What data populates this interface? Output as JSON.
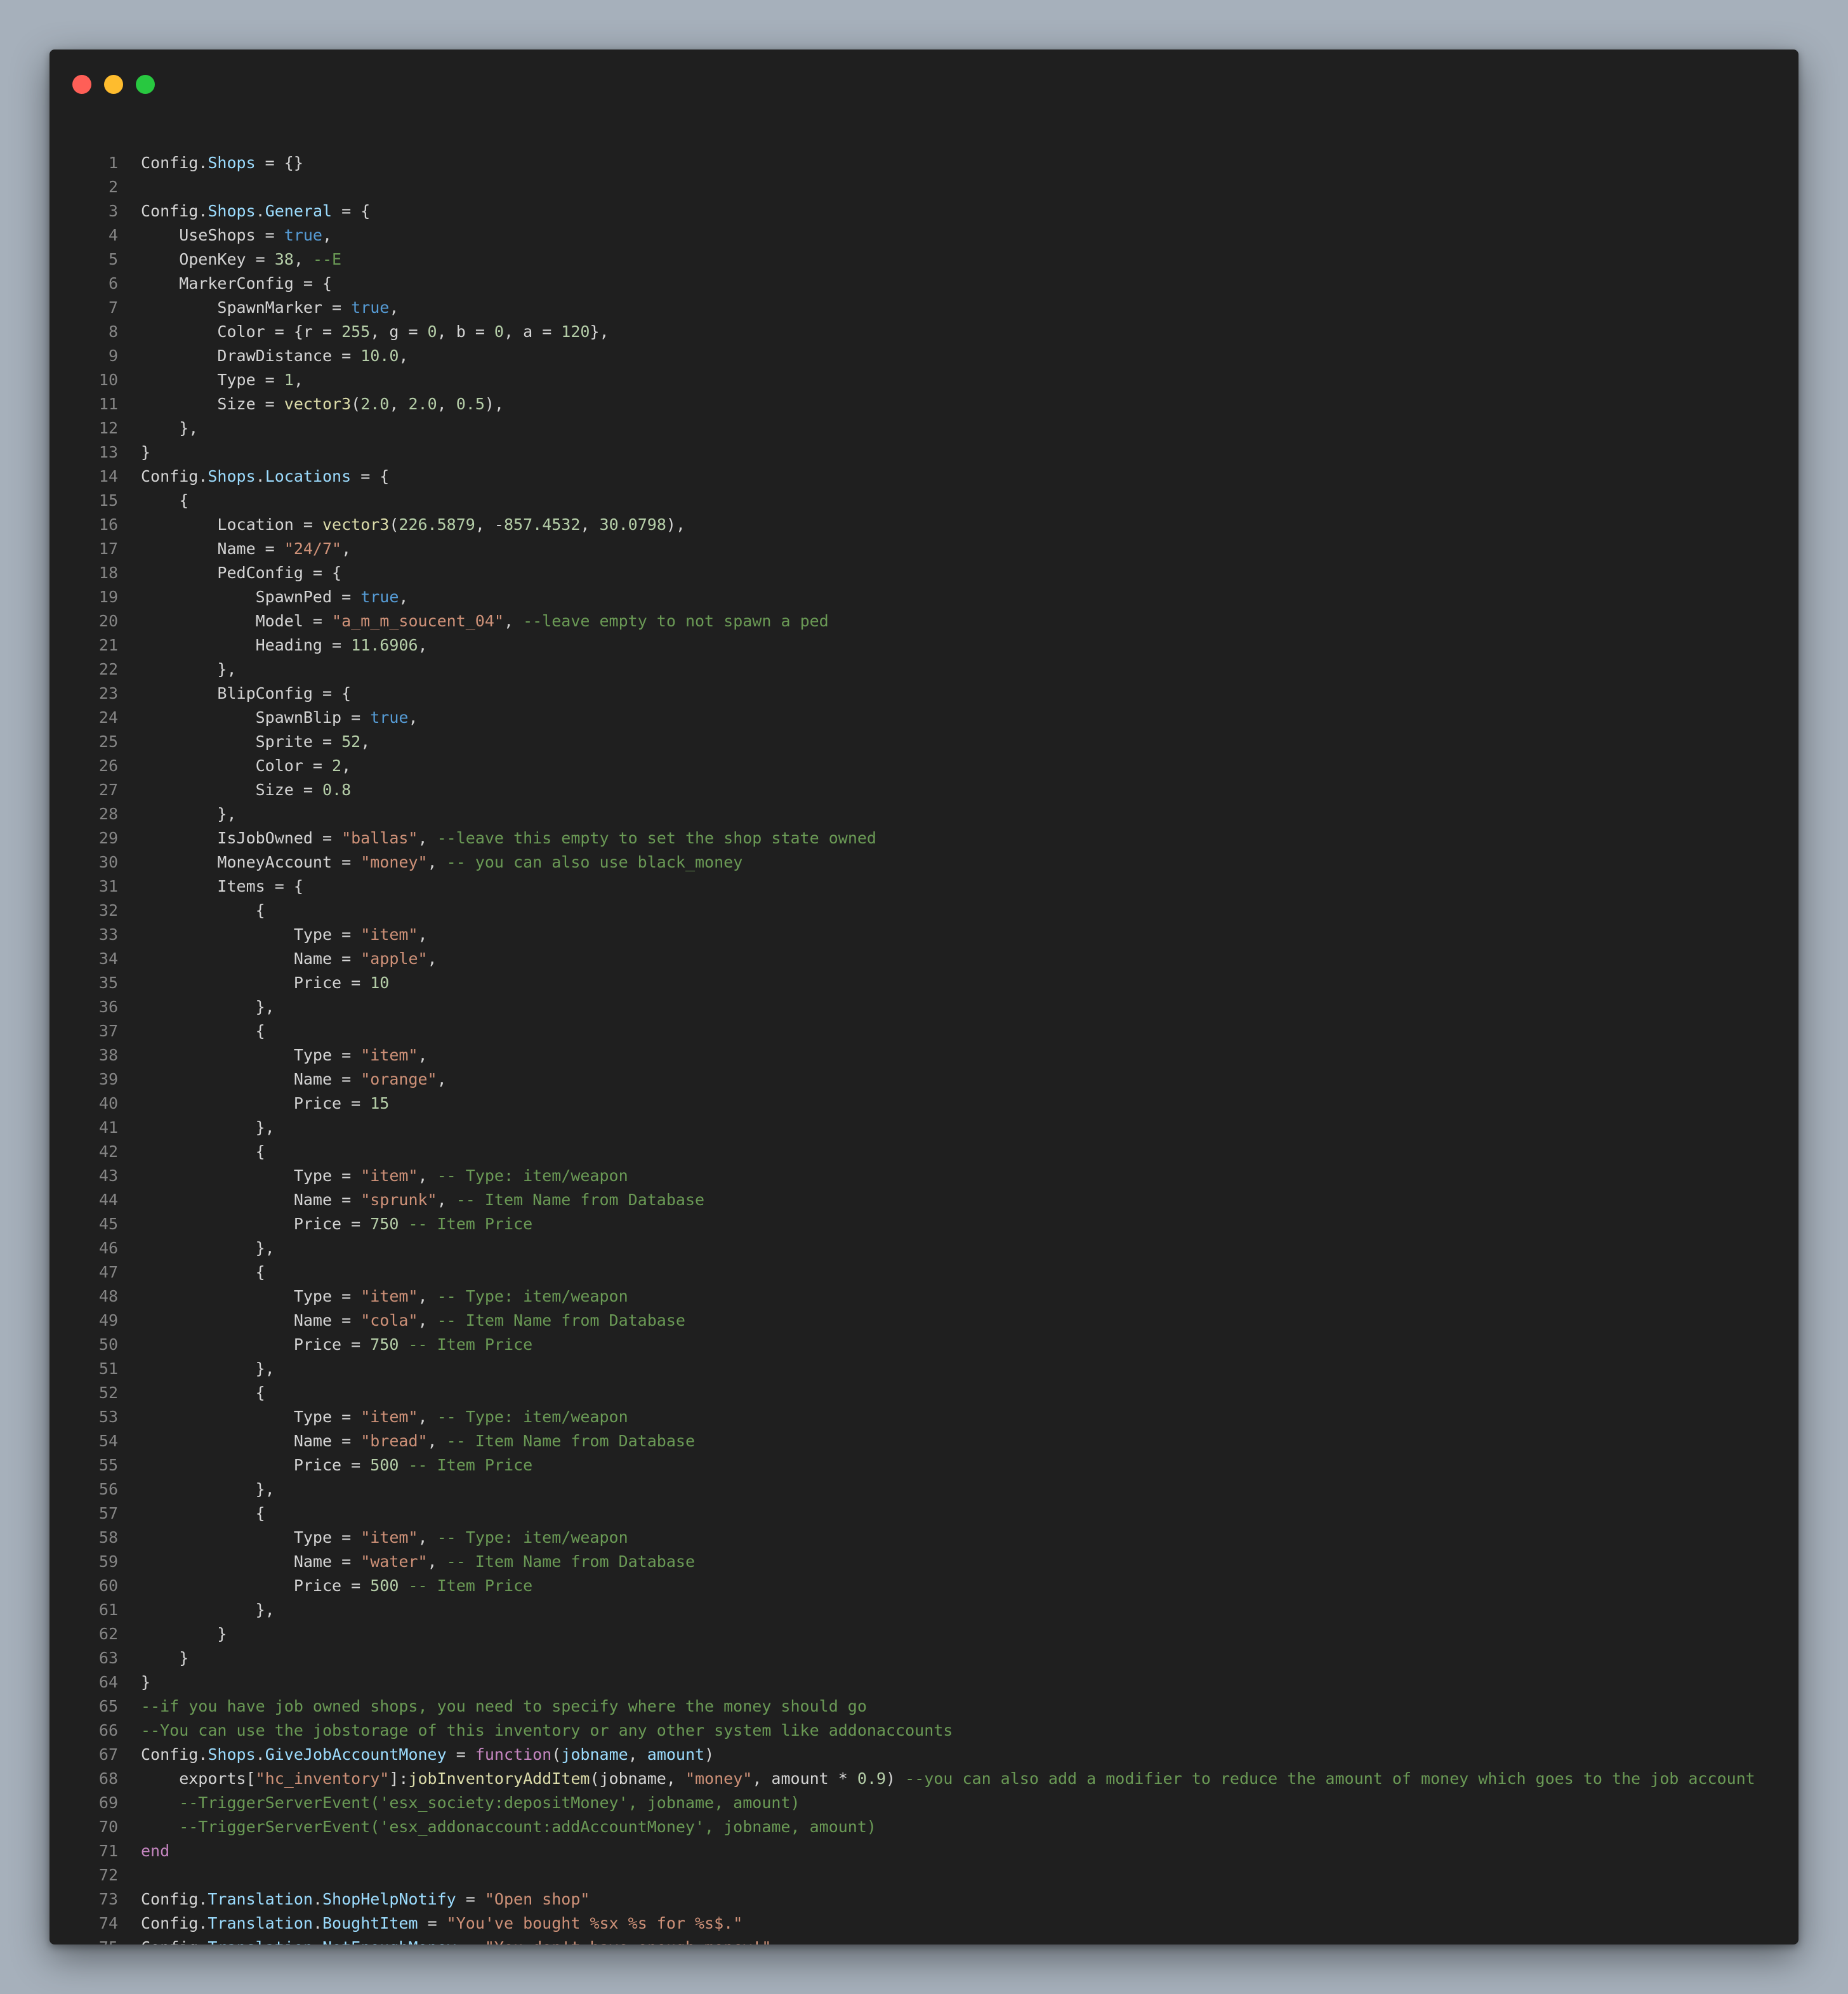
{
  "window": {
    "controls": [
      {
        "name": "close",
        "color": "#ff5f57"
      },
      {
        "name": "minimize",
        "color": "#febc2e"
      },
      {
        "name": "maximize",
        "color": "#28c840"
      }
    ]
  },
  "colors": {
    "plain": "#d4d4d4",
    "property": "#9cdcfe",
    "boolean": "#569cd6",
    "number": "#b5cea8",
    "string": "#ce9178",
    "comment": "#6a9955",
    "function": "#dcdcaa",
    "control": "#c586c0",
    "line_number": "#858585",
    "background": "#1f1f1f"
  },
  "code": {
    "lines": [
      [
        [
          "p",
          "Config."
        ],
        [
          "prop",
          "Shops"
        ],
        [
          "p",
          " = {}"
        ]
      ],
      [],
      [
        [
          "p",
          "Config."
        ],
        [
          "prop",
          "Shops"
        ],
        [
          "p",
          "."
        ],
        [
          "prop",
          "General"
        ],
        [
          "p",
          " = {"
        ]
      ],
      [
        [
          "p",
          "    UseShops = "
        ],
        [
          "kw",
          "true"
        ],
        [
          "p",
          ","
        ]
      ],
      [
        [
          "p",
          "    OpenKey = "
        ],
        [
          "num",
          "38"
        ],
        [
          "p",
          ", "
        ],
        [
          "com",
          "--E"
        ]
      ],
      [
        [
          "p",
          "    MarkerConfig = {"
        ]
      ],
      [
        [
          "p",
          "        SpawnMarker = "
        ],
        [
          "kw",
          "true"
        ],
        [
          "p",
          ","
        ]
      ],
      [
        [
          "p",
          "        Color = {r = "
        ],
        [
          "num",
          "255"
        ],
        [
          "p",
          ", g = "
        ],
        [
          "num",
          "0"
        ],
        [
          "p",
          ", b = "
        ],
        [
          "num",
          "0"
        ],
        [
          "p",
          ", a = "
        ],
        [
          "num",
          "120"
        ],
        [
          "p",
          "},"
        ]
      ],
      [
        [
          "p",
          "        DrawDistance = "
        ],
        [
          "num",
          "10.0"
        ],
        [
          "p",
          ","
        ]
      ],
      [
        [
          "p",
          "        Type = "
        ],
        [
          "num",
          "1"
        ],
        [
          "p",
          ","
        ]
      ],
      [
        [
          "p",
          "        Size = "
        ],
        [
          "fn",
          "vector3"
        ],
        [
          "p",
          "("
        ],
        [
          "num",
          "2.0"
        ],
        [
          "p",
          ", "
        ],
        [
          "num",
          "2.0"
        ],
        [
          "p",
          ", "
        ],
        [
          "num",
          "0.5"
        ],
        [
          "p",
          "),"
        ]
      ],
      [
        [
          "p",
          "    },"
        ]
      ],
      [
        [
          "p",
          "}"
        ]
      ],
      [
        [
          "p",
          "Config."
        ],
        [
          "prop",
          "Shops"
        ],
        [
          "p",
          "."
        ],
        [
          "prop",
          "Locations"
        ],
        [
          "p",
          " = {"
        ]
      ],
      [
        [
          "p",
          "    {"
        ]
      ],
      [
        [
          "p",
          "        Location = "
        ],
        [
          "fn",
          "vector3"
        ],
        [
          "p",
          "("
        ],
        [
          "num",
          "226.5879"
        ],
        [
          "p",
          ", -"
        ],
        [
          "num",
          "857.4532"
        ],
        [
          "p",
          ", "
        ],
        [
          "num",
          "30.0798"
        ],
        [
          "p",
          "),"
        ]
      ],
      [
        [
          "p",
          "        Name = "
        ],
        [
          "str",
          "\"24/7\""
        ],
        [
          "p",
          ","
        ]
      ],
      [
        [
          "p",
          "        PedConfig = {"
        ]
      ],
      [
        [
          "p",
          "            SpawnPed = "
        ],
        [
          "kw",
          "true"
        ],
        [
          "p",
          ","
        ]
      ],
      [
        [
          "p",
          "            Model = "
        ],
        [
          "str",
          "\"a_m_m_soucent_04\""
        ],
        [
          "p",
          ", "
        ],
        [
          "com",
          "--leave empty to not spawn a ped"
        ]
      ],
      [
        [
          "p",
          "            Heading = "
        ],
        [
          "num",
          "11.6906"
        ],
        [
          "p",
          ","
        ]
      ],
      [
        [
          "p",
          "        },"
        ]
      ],
      [
        [
          "p",
          "        BlipConfig = {"
        ]
      ],
      [
        [
          "p",
          "            SpawnBlip = "
        ],
        [
          "kw",
          "true"
        ],
        [
          "p",
          ","
        ]
      ],
      [
        [
          "p",
          "            Sprite = "
        ],
        [
          "num",
          "52"
        ],
        [
          "p",
          ","
        ]
      ],
      [
        [
          "p",
          "            Color = "
        ],
        [
          "num",
          "2"
        ],
        [
          "p",
          ","
        ]
      ],
      [
        [
          "p",
          "            Size = "
        ],
        [
          "num",
          "0.8"
        ]
      ],
      [
        [
          "p",
          "        },"
        ]
      ],
      [
        [
          "p",
          "        IsJobOwned = "
        ],
        [
          "str",
          "\"ballas\""
        ],
        [
          "p",
          ", "
        ],
        [
          "com",
          "--leave this empty to set the shop state owned"
        ]
      ],
      [
        [
          "p",
          "        MoneyAccount = "
        ],
        [
          "str",
          "\"money\""
        ],
        [
          "p",
          ", "
        ],
        [
          "com",
          "-- you can also use black_money"
        ]
      ],
      [
        [
          "p",
          "        Items = {"
        ]
      ],
      [
        [
          "p",
          "            {"
        ]
      ],
      [
        [
          "p",
          "                Type = "
        ],
        [
          "str",
          "\"item\""
        ],
        [
          "p",
          ","
        ]
      ],
      [
        [
          "p",
          "                Name = "
        ],
        [
          "str",
          "\"apple\""
        ],
        [
          "p",
          ","
        ]
      ],
      [
        [
          "p",
          "                Price = "
        ],
        [
          "num",
          "10"
        ]
      ],
      [
        [
          "p",
          "            },"
        ]
      ],
      [
        [
          "p",
          "            {"
        ]
      ],
      [
        [
          "p",
          "                Type = "
        ],
        [
          "str",
          "\"item\""
        ],
        [
          "p",
          ","
        ]
      ],
      [
        [
          "p",
          "                Name = "
        ],
        [
          "str",
          "\"orange\""
        ],
        [
          "p",
          ","
        ]
      ],
      [
        [
          "p",
          "                Price = "
        ],
        [
          "num",
          "15"
        ]
      ],
      [
        [
          "p",
          "            },"
        ]
      ],
      [
        [
          "p",
          "            {"
        ]
      ],
      [
        [
          "p",
          "                Type = "
        ],
        [
          "str",
          "\"item\""
        ],
        [
          "p",
          ", "
        ],
        [
          "com",
          "-- Type: item/weapon"
        ]
      ],
      [
        [
          "p",
          "                Name = "
        ],
        [
          "str",
          "\"sprunk\""
        ],
        [
          "p",
          ", "
        ],
        [
          "com",
          "-- Item Name from Database"
        ]
      ],
      [
        [
          "p",
          "                Price = "
        ],
        [
          "num",
          "750"
        ],
        [
          "p",
          " "
        ],
        [
          "com",
          "-- Item Price"
        ]
      ],
      [
        [
          "p",
          "            },"
        ]
      ],
      [
        [
          "p",
          "            {"
        ]
      ],
      [
        [
          "p",
          "                Type = "
        ],
        [
          "str",
          "\"item\""
        ],
        [
          "p",
          ", "
        ],
        [
          "com",
          "-- Type: item/weapon"
        ]
      ],
      [
        [
          "p",
          "                Name = "
        ],
        [
          "str",
          "\"cola\""
        ],
        [
          "p",
          ", "
        ],
        [
          "com",
          "-- Item Name from Database"
        ]
      ],
      [
        [
          "p",
          "                Price = "
        ],
        [
          "num",
          "750"
        ],
        [
          "p",
          " "
        ],
        [
          "com",
          "-- Item Price"
        ]
      ],
      [
        [
          "p",
          "            },"
        ]
      ],
      [
        [
          "p",
          "            {"
        ]
      ],
      [
        [
          "p",
          "                Type = "
        ],
        [
          "str",
          "\"item\""
        ],
        [
          "p",
          ", "
        ],
        [
          "com",
          "-- Type: item/weapon"
        ]
      ],
      [
        [
          "p",
          "                Name = "
        ],
        [
          "str",
          "\"bread\""
        ],
        [
          "p",
          ", "
        ],
        [
          "com",
          "-- Item Name from Database"
        ]
      ],
      [
        [
          "p",
          "                Price = "
        ],
        [
          "num",
          "500"
        ],
        [
          "p",
          " "
        ],
        [
          "com",
          "-- Item Price"
        ]
      ],
      [
        [
          "p",
          "            },"
        ]
      ],
      [
        [
          "p",
          "            {"
        ]
      ],
      [
        [
          "p",
          "                Type = "
        ],
        [
          "str",
          "\"item\""
        ],
        [
          "p",
          ", "
        ],
        [
          "com",
          "-- Type: item/weapon"
        ]
      ],
      [
        [
          "p",
          "                Name = "
        ],
        [
          "str",
          "\"water\""
        ],
        [
          "p",
          ", "
        ],
        [
          "com",
          "-- Item Name from Database"
        ]
      ],
      [
        [
          "p",
          "                Price = "
        ],
        [
          "num",
          "500"
        ],
        [
          "p",
          " "
        ],
        [
          "com",
          "-- Item Price"
        ]
      ],
      [
        [
          "p",
          "            },"
        ]
      ],
      [
        [
          "p",
          "        }"
        ]
      ],
      [
        [
          "p",
          "    }"
        ]
      ],
      [
        [
          "p",
          "}"
        ]
      ],
      [
        [
          "com",
          "--if you have job owned shops, you need to specify where the money should go"
        ]
      ],
      [
        [
          "com",
          "--You can use the jobstorage of this inventory or any other system like addonaccounts"
        ]
      ],
      [
        [
          "p",
          "Config."
        ],
        [
          "prop",
          "Shops"
        ],
        [
          "p",
          "."
        ],
        [
          "prop",
          "GiveJobAccountMoney"
        ],
        [
          "p",
          " = "
        ],
        [
          "kw2",
          "function"
        ],
        [
          "p",
          "("
        ],
        [
          "prop",
          "jobname"
        ],
        [
          "p",
          ", "
        ],
        [
          "prop",
          "amount"
        ],
        [
          "p",
          ")"
        ]
      ],
      [
        [
          "p",
          "    exports["
        ],
        [
          "str",
          "\"hc_inventory\""
        ],
        [
          "p",
          "]:"
        ],
        [
          "fn",
          "jobInventoryAddItem"
        ],
        [
          "p",
          "(jobname, "
        ],
        [
          "str",
          "\"money\""
        ],
        [
          "p",
          ", amount * "
        ],
        [
          "num",
          "0.9"
        ],
        [
          "p",
          ") "
        ],
        [
          "com",
          "--you can also add a modifier to reduce the amount of money which goes to the job account"
        ]
      ],
      [
        [
          "com",
          "    --TriggerServerEvent('esx_society:depositMoney', jobname, amount)"
        ]
      ],
      [
        [
          "com",
          "    --TriggerServerEvent('esx_addonaccount:addAccountMoney', jobname, amount)"
        ]
      ],
      [
        [
          "kw2",
          "end"
        ]
      ],
      [],
      [
        [
          "p",
          "Config."
        ],
        [
          "prop",
          "Translation"
        ],
        [
          "p",
          "."
        ],
        [
          "prop",
          "ShopHelpNotify"
        ],
        [
          "p",
          " = "
        ],
        [
          "str",
          "\"Open shop\""
        ]
      ],
      [
        [
          "p",
          "Config."
        ],
        [
          "prop",
          "Translation"
        ],
        [
          "p",
          "."
        ],
        [
          "prop",
          "BoughtItem"
        ],
        [
          "p",
          " = "
        ],
        [
          "str",
          "\"You've bought %sx %s for %s$.\""
        ]
      ],
      [
        [
          "p",
          "Config."
        ],
        [
          "prop",
          "Translation"
        ],
        [
          "p",
          "."
        ],
        [
          "prop",
          "NotEnoughMoney"
        ],
        [
          "p",
          " = "
        ],
        [
          "str",
          "\"You don't have enough money!\""
        ]
      ]
    ]
  }
}
